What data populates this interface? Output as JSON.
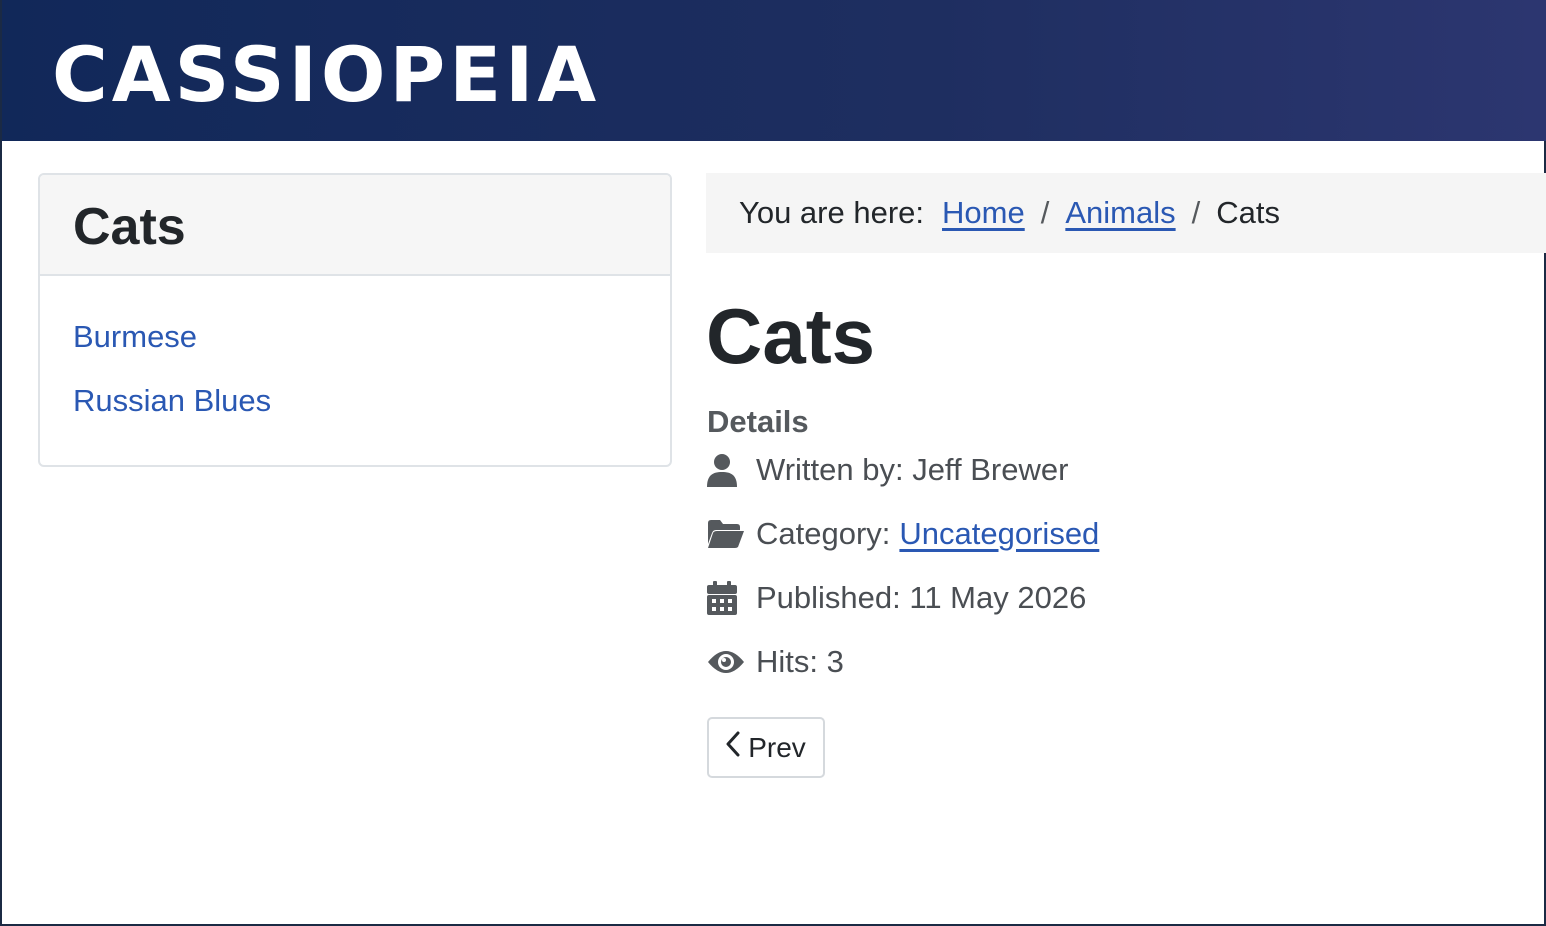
{
  "header": {
    "brand": "CASSIOPEIA"
  },
  "sidebar": {
    "title": "Cats",
    "items": [
      {
        "label": "Burmese"
      },
      {
        "label": "Russian Blues"
      }
    ]
  },
  "breadcrumb": {
    "lead": "You are here:",
    "items": [
      {
        "label": "Home"
      },
      {
        "label": "Animals"
      },
      {
        "label": "Cats"
      }
    ],
    "separator": "/"
  },
  "article": {
    "title": "Cats",
    "details_label": "Details",
    "author": "Written by: Jeff Brewer",
    "category_prefix": "Category:",
    "category": "Uncategorised",
    "published": "Published: 11 May 2026",
    "hits": "Hits: 3",
    "prev_label": "Prev"
  },
  "icons": {
    "author": "user-icon",
    "category": "folder-open-icon",
    "published": "calendar-icon",
    "hits": "eye-icon",
    "prev": "chevron-left-icon"
  },
  "colors": {
    "header_start": "#112859",
    "header_end": "#2c3670",
    "link": "#2a58b3",
    "text": "#22262a",
    "muted": "#4a4e53"
  }
}
